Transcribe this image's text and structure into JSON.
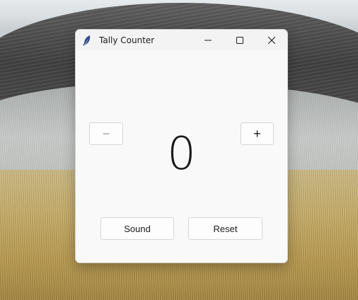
{
  "window": {
    "title": "Tally Counter",
    "icon": "feather-icon"
  },
  "caption": {
    "minimize_icon": "minimize-icon",
    "maximize_icon": "maximize-icon",
    "close_icon": "close-icon"
  },
  "counter": {
    "value": "0",
    "decrement_label": "−",
    "increment_label": "+"
  },
  "actions": {
    "sound_label": "Sound",
    "reset_label": "Reset"
  }
}
